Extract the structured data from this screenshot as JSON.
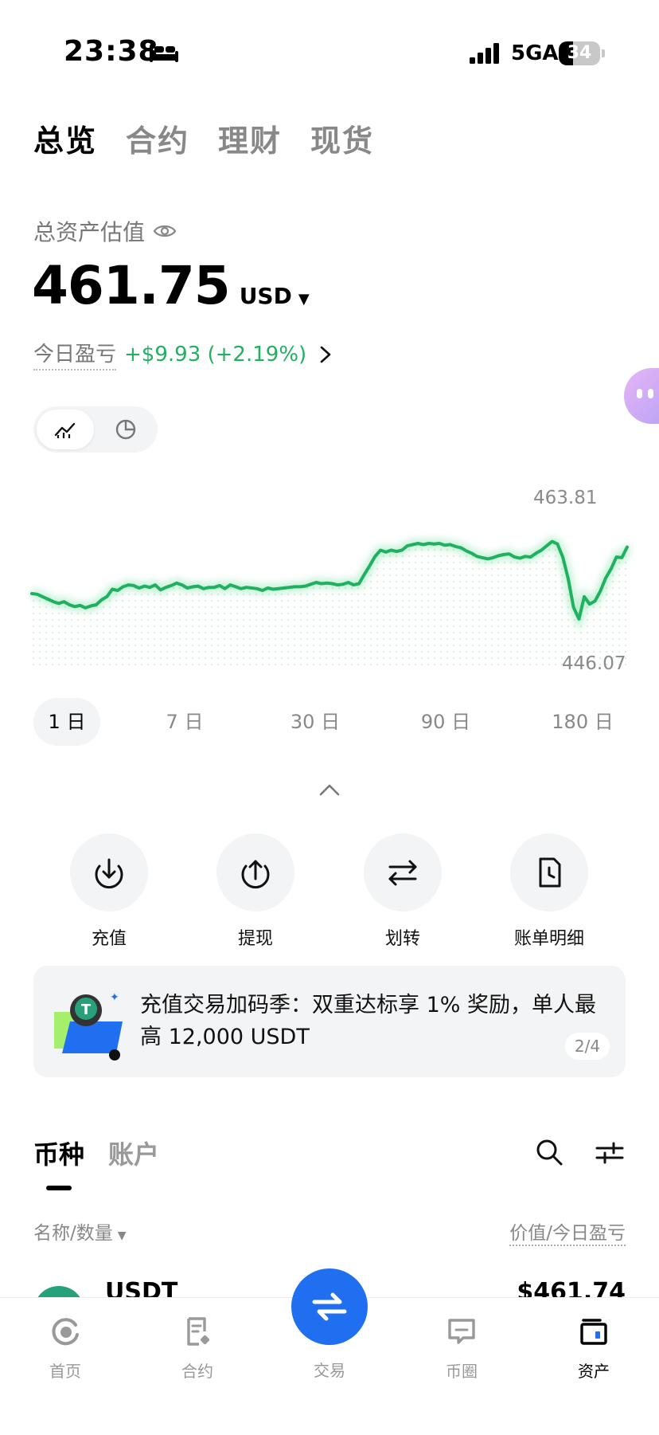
{
  "status_bar": {
    "time": "23:38",
    "network": "5GA",
    "battery": "34",
    "battery_level": 0.34
  },
  "top_tabs": [
    "总览",
    "合约",
    "理财",
    "现货"
  ],
  "summary": {
    "label": "总资产估值",
    "balance": "461.75",
    "currency": "USD",
    "pnl_label": "今日盈亏",
    "pnl_value": "+$9.93 (+2.19%)",
    "pnl_color": "#1fb160"
  },
  "chart": {
    "max_label": "463.81",
    "min_label": "446.07"
  },
  "chart_data": {
    "type": "line",
    "range": "1 日",
    "y_max": 463.81,
    "y_min": 446.07,
    "line_color": "#1fb160",
    "values": [
      451.6,
      451.5,
      451.1,
      450.7,
      450.3,
      450.0,
      450.3,
      449.8,
      449.5,
      449.7,
      449.3,
      449.6,
      449.8,
      450.6,
      451.1,
      452.3,
      452.1,
      452.7,
      453.0,
      452.9,
      452.5,
      452.8,
      452.6,
      453.0,
      452.2,
      452.6,
      452.9,
      453.3,
      453.0,
      452.5,
      452.7,
      452.8,
      452.4,
      452.6,
      452.6,
      452.9,
      452.4,
      453.0,
      452.7,
      452.4,
      452.6,
      452.5,
      452.4,
      452.1,
      452.5,
      452.3,
      452.4,
      452.5,
      452.6,
      452.7,
      452.7,
      452.8,
      453.1,
      453.4,
      453.2,
      453.3,
      453.2,
      453.0,
      453.1,
      453.4,
      453.0,
      453.2,
      454.7,
      456.1,
      457.6,
      458.6,
      458.3,
      458.6,
      458.4,
      458.6,
      459.3,
      459.5,
      459.7,
      459.5,
      459.7,
      459.6,
      459.7,
      459.4,
      459.5,
      459.2,
      459.0,
      458.5,
      458.1,
      457.6,
      457.4,
      457.2,
      457.4,
      457.7,
      457.9,
      458.0,
      457.5,
      457.3,
      457.6,
      457.5,
      458.1,
      458.6,
      459.3,
      460.0,
      459.6,
      457.5,
      454.0,
      449.4,
      447.5,
      451.1,
      449.9,
      450.4,
      452.0,
      454.1,
      455.6,
      457.5,
      457.4,
      459.1
    ]
  },
  "range_tabs": [
    "1 日",
    "7 日",
    "30 日",
    "90 日",
    "180 日"
  ],
  "actions": [
    "充值",
    "提现",
    "划转",
    "账单明细"
  ],
  "banner": {
    "text": "充值交易加码季：双重达标享 1% 奖励，单人最高 12,000 USDT",
    "page": "2/4"
  },
  "list": {
    "tabs": [
      "币种",
      "账户"
    ],
    "col_name": "名称/数量",
    "col_value": "价值/今日盈亏"
  },
  "asset_row": {
    "name": "USDT",
    "value": "$461.74"
  },
  "bottom_nav": {
    "items": [
      "首页",
      "合约",
      "交易",
      "币圈",
      "资产"
    ]
  }
}
